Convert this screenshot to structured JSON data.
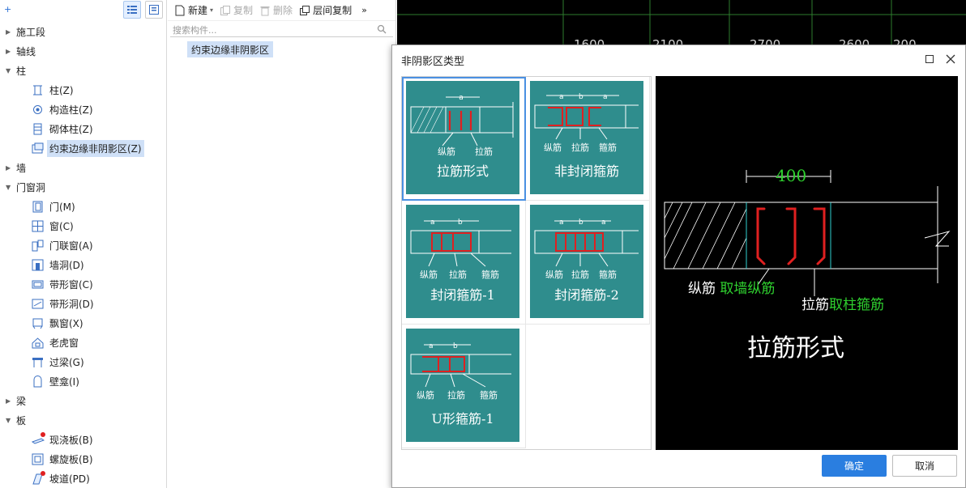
{
  "tree": {
    "items": [
      {
        "label": "施工段",
        "type": "group"
      },
      {
        "label": "轴线",
        "type": "group"
      },
      {
        "label": "柱",
        "type": "group-open"
      },
      {
        "label": "柱(Z)",
        "type": "child",
        "icon": "column-icon"
      },
      {
        "label": "构造柱(Z)",
        "type": "child",
        "icon": "structural-column-icon"
      },
      {
        "label": "砌体柱(Z)",
        "type": "child",
        "icon": "masonry-column-icon"
      },
      {
        "label": "约束边缘非阴影区(Z)",
        "type": "child",
        "icon": "constraint-edge-icon",
        "selected": true
      },
      {
        "label": "墙",
        "type": "group"
      },
      {
        "label": "门窗洞",
        "type": "group-open"
      },
      {
        "label": "门(M)",
        "type": "child",
        "icon": "door-icon"
      },
      {
        "label": "窗(C)",
        "type": "child",
        "icon": "window-icon"
      },
      {
        "label": "门联窗(A)",
        "type": "child",
        "icon": "door-window-icon"
      },
      {
        "label": "墙洞(D)",
        "type": "child",
        "icon": "wall-opening-icon"
      },
      {
        "label": "带形窗(C)",
        "type": "child",
        "icon": "strip-window-icon"
      },
      {
        "label": "带形洞(D)",
        "type": "child",
        "icon": "strip-opening-icon"
      },
      {
        "label": "飘窗(X)",
        "type": "child",
        "icon": "bay-window-icon"
      },
      {
        "label": "老虎窗",
        "type": "child",
        "icon": "dormer-icon"
      },
      {
        "label": "过梁(G)",
        "type": "child",
        "icon": "lintel-icon"
      },
      {
        "label": "壁龛(I)",
        "type": "child",
        "icon": "niche-icon"
      },
      {
        "label": "梁",
        "type": "group"
      },
      {
        "label": "板",
        "type": "group-open"
      },
      {
        "label": "现浇板(B)",
        "type": "child",
        "icon": "cast-slab-icon",
        "dot": true
      },
      {
        "label": "螺旋板(B)",
        "type": "child",
        "icon": "spiral-slab-icon"
      },
      {
        "label": "坡道(PD)",
        "type": "child",
        "icon": "ramp-icon",
        "dot": true
      }
    ]
  },
  "toolbar": {
    "new": "新建",
    "copy": "复制",
    "delete": "删除",
    "floor_copy": "层间复制",
    "more": "»"
  },
  "search": {
    "placeholder": "搜索构件..."
  },
  "component": {
    "name": "约束边缘非阴影区"
  },
  "cad": {
    "dims": [
      "1600",
      "2100",
      "2700",
      "2600",
      "200"
    ]
  },
  "dialog": {
    "title": "非阴影区类型",
    "tiles": [
      {
        "caption": "拉筋形式",
        "labels": [
          "a",
          "纵筋",
          "拉筋"
        ]
      },
      {
        "caption": "非封闭箍筋",
        "labels": [
          "a",
          "b",
          "a",
          "纵筋",
          "拉筋",
          "箍筋"
        ]
      },
      {
        "caption": "封闭箍筋-1",
        "labels": [
          "a",
          "b",
          "纵筋",
          "拉筋",
          "箍筋"
        ]
      },
      {
        "caption": "封闭箍筋-2",
        "labels": [
          "a",
          "b",
          "a",
          "纵筋",
          "拉筋",
          "箍筋"
        ]
      },
      {
        "caption": "U形箍筋-1",
        "labels": [
          "a",
          "b",
          "纵筋",
          "拉筋",
          "箍筋"
        ]
      }
    ],
    "preview": {
      "dim": "400",
      "label1a": "纵筋 ",
      "label1b": "取墙纵筋",
      "label2a": "拉筋",
      "label2b": "取柱箍筋",
      "title": "拉筋形式"
    },
    "ok": "确定",
    "cancel": "取消"
  },
  "colors": {
    "tile": "#2f8d8d",
    "accent": "#2a7ee0",
    "rebar": "#e02020",
    "green": "#2fd12f"
  }
}
